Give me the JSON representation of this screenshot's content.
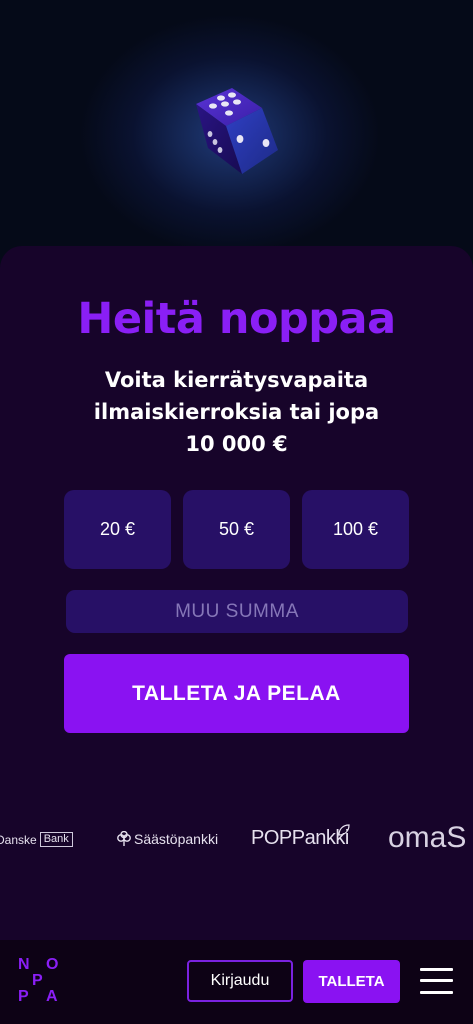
{
  "hero": {
    "image": "dice-icon"
  },
  "promo": {
    "title": "Heitä noppaa",
    "subtitle_line1": "Voita kierrätysvapaita",
    "subtitle_line2": "ilmaiskierroksia tai jopa",
    "subtitle_line3": "10 000 €"
  },
  "amounts": [
    "20 €",
    "50 €",
    "100 €"
  ],
  "other_amount": {
    "placeholder": "MUU SUMMA"
  },
  "cta": {
    "label": "TALLETA JA PELAA"
  },
  "banks": {
    "danske_text": "Danske",
    "danske_box": "Bank",
    "saastopankki": "Säästöpankki",
    "pop_a": "POP",
    "pop_b": "Pankki",
    "oma": "omaS"
  },
  "navbar": {
    "logo_letters": [
      "N",
      "O",
      "P",
      "P",
      "A"
    ],
    "login_label": "Kirjaudu",
    "deposit_label": "TALLETA",
    "menu_icon": "hamburger-menu-icon"
  },
  "colors": {
    "accent": "#8a12f2",
    "title": "#8a1ff5",
    "card": "#17042a",
    "tile": "#271066"
  }
}
